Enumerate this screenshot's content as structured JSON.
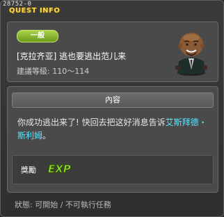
{
  "window": {
    "quest_id": "28752-0",
    "title": "QUEST INFO"
  },
  "quest": {
    "category": "一般",
    "name": "[克拉齐亚] 逃也要逃出范儿来",
    "level": "建議等級: 110～114"
  },
  "content": {
    "header": "內容",
    "text_before": "你成功逃出来了! 快回去把这好消息告诉",
    "npc_name": "艾斯拜德・斯利姆",
    "text_after": "。"
  },
  "reward": {
    "label": "獎勵",
    "exp_icon_text": "EXP"
  },
  "status": "狀態: 可開始 / 不可執行任務",
  "colors": {
    "title_yellow": "#ffd94a",
    "badge_green": "#8bbb2c",
    "npc_highlight": "#5fe4ff",
    "exp_green": "#9de62e"
  }
}
